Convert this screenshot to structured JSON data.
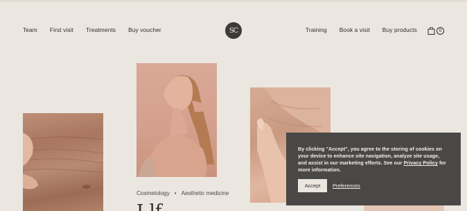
{
  "nav": {
    "left": [
      "Team",
      "First visit",
      "Treatments",
      "Buy voucher"
    ],
    "right": [
      "Training",
      "Book a visit",
      "Buy products"
    ],
    "cart_count": "0"
  },
  "logo": {
    "text": "SC"
  },
  "article": {
    "tags": [
      "Cosmetology",
      "Aesthetic medicine"
    ],
    "headline_partial": "I          lf"
  },
  "cookie": {
    "text_before": "By clicking \"Accept\", you agree to the storing of cookies on your device to enhance site navigation, analyze site usage, and assist in our marketing efforts. See our ",
    "privacy_link": "Privacy Policy",
    "text_after": " for more information.",
    "accept_label": "Accept",
    "preferences_label": "Preferences"
  },
  "colors": {
    "background": "#ebe6e0",
    "text": "#2f2b28",
    "banner": "#4a4846",
    "logo_bg": "#3d3a38"
  },
  "icons": [
    "bag-icon"
  ]
}
